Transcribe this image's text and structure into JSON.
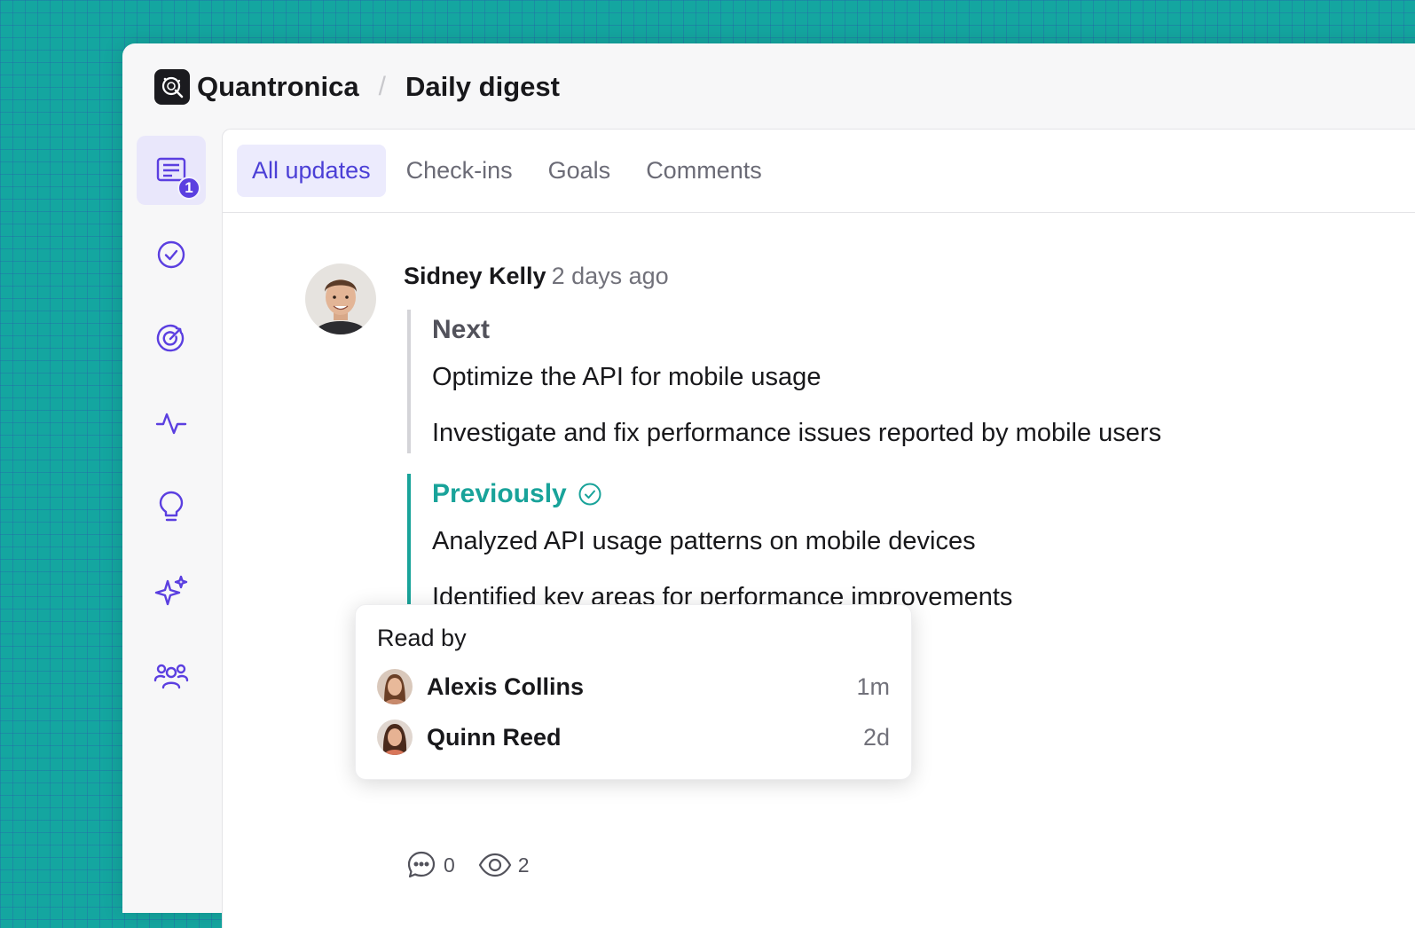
{
  "app": {
    "name": "Quantronica",
    "separator": "/",
    "page_title": "Daily digest"
  },
  "sidebar": {
    "items": [
      {
        "icon": "updates-icon",
        "badge": "1",
        "active": true
      },
      {
        "icon": "check-circle-icon"
      },
      {
        "icon": "target-icon"
      },
      {
        "icon": "activity-icon"
      },
      {
        "icon": "lightbulb-icon"
      },
      {
        "icon": "sparkles-icon"
      },
      {
        "icon": "people-icon"
      }
    ],
    "accent": "#5b3fe0"
  },
  "tabs": [
    {
      "label": "All updates",
      "active": true
    },
    {
      "label": "Check-ins"
    },
    {
      "label": "Goals"
    },
    {
      "label": "Comments"
    }
  ],
  "post": {
    "author": "Sidney Kelly",
    "time": "2 days ago",
    "next": {
      "title": "Next",
      "items": [
        "Optimize the API for mobile usage",
        "Investigate and fix performance issues reported by mobile users"
      ]
    },
    "previously": {
      "title": "Previously",
      "color": "#19a39a",
      "items": [
        "Analyzed API usage patterns on mobile devices",
        "Identified key areas for performance improvements"
      ]
    },
    "comments_count": "0",
    "views_count": "2"
  },
  "read_by": {
    "title": "Read by",
    "readers": [
      {
        "name": "Alexis Collins",
        "time": "1m"
      },
      {
        "name": "Quinn Reed",
        "time": "2d"
      }
    ]
  }
}
